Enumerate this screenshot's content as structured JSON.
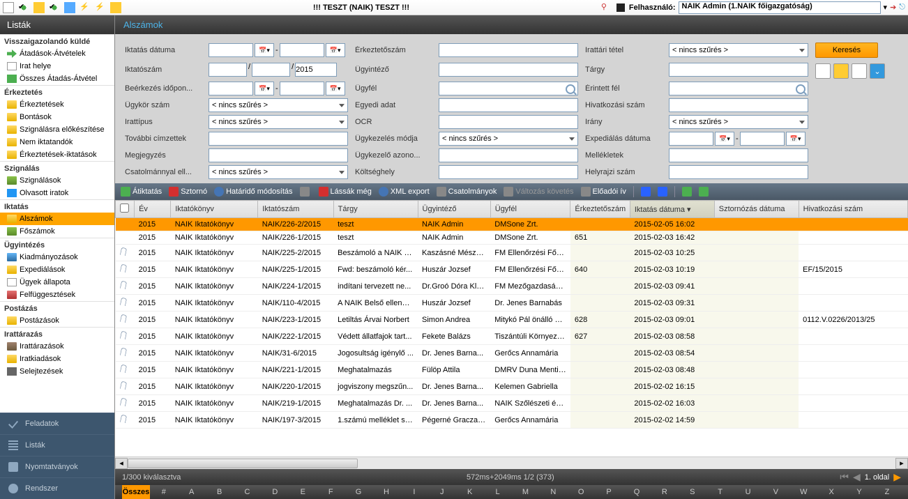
{
  "topbar": {
    "title": "!!! TESZT (NAIK) TESZT !!!",
    "user_label": "Felhasználó:",
    "user_value": "NAIK Admin (1.NAIK főigazgatóság)"
  },
  "sidebar": {
    "title": "Listák",
    "groups": [
      {
        "label": "Visszaigazolandó küldé",
        "items": [
          {
            "icon": "icon-arrows",
            "label": "Átadások-Átvételek"
          },
          {
            "icon": "icon-paper",
            "label": "Irat helye"
          },
          {
            "icon": "icon-grid",
            "label": "Összes Átadás-Átvétel"
          }
        ]
      },
      {
        "label": "Érkeztetés",
        "items": [
          {
            "icon": "folder-yellow",
            "label": "Érkeztetések"
          },
          {
            "icon": "folder-yellow",
            "label": "Bontások"
          },
          {
            "icon": "folder-yellow",
            "label": "Szignálásra előkészítése"
          },
          {
            "icon": "folder-yellow",
            "label": "Nem iktatandók"
          },
          {
            "icon": "folder-yellow",
            "label": "Érkeztetések-iktatások"
          }
        ]
      },
      {
        "label": "Szignálás",
        "items": [
          {
            "icon": "folder-green",
            "label": "Szignálások"
          },
          {
            "icon": "icon-check-blue",
            "label": "Olvasott iratok"
          }
        ]
      },
      {
        "label": "Iktatás",
        "items": [
          {
            "icon": "folder-yellow",
            "label": "Alszámok",
            "active": true
          },
          {
            "icon": "folder-green",
            "label": "Főszámok"
          }
        ]
      },
      {
        "label": "Ügyintézés",
        "items": [
          {
            "icon": "folder-blue",
            "label": "Kiadmányozások"
          },
          {
            "icon": "folder-yellow",
            "label": "Expediálások"
          },
          {
            "icon": "icon-paper",
            "label": "Ügyek állapota"
          },
          {
            "icon": "folder-red",
            "label": "Felfüggesztések"
          }
        ]
      },
      {
        "label": "Postázás",
        "items": [
          {
            "icon": "folder-yellow",
            "label": "Postázások"
          }
        ]
      },
      {
        "label": "Irattárazás",
        "items": [
          {
            "icon": "folder-brown",
            "label": "Irattárazások"
          },
          {
            "icon": "folder-yellow",
            "label": "Iratkiadások"
          },
          {
            "icon": "icon-trash",
            "label": "Selejtezések"
          }
        ]
      }
    ],
    "bottom": [
      {
        "icon": "sb-check",
        "label": "Feladatok"
      },
      {
        "icon": "sb-lines",
        "label": "Listák"
      },
      {
        "icon": "sb-print",
        "label": "Nyomtatványok"
      },
      {
        "icon": "sb-gear",
        "label": "Rendszer"
      }
    ]
  },
  "content_title": "Alszámok",
  "filters": {
    "labels": {
      "iktatas_datuma": "Iktatás dátuma",
      "iktatoszam": "Iktatószám",
      "beerkezes": "Beérkezés időpon...",
      "ugykor": "Ügykör szám",
      "irattipus": "Irattípus",
      "tovabbi": "További címzettek",
      "megjegyzes": "Megjegyzés",
      "csatolmany": "Csatolmánnyal ell...",
      "erkeztetoszam": "Érkeztetőszám",
      "ugyintezo": "Ügyintéző",
      "ugyfel": "Ügyfél",
      "egyediadat": "Egyedi adat",
      "ocr": "OCR",
      "ugykezelesmodja": "Ügykezelés módja",
      "ugykezeloazon": "Ügykezelő azono...",
      "koltseghely": "Költséghely",
      "irattaritetl": "Irattári tétel",
      "targy": "Tárgy",
      "erintettfel": "Érintett fél",
      "hivatkozasiszam": "Hivatkozási szám",
      "irany": "Irány",
      "expedialas": "Expediálás dátuma",
      "mellekletek": "Mellékletek",
      "helyrajziszam": "Helyrajzi szám"
    },
    "nofilter": "< nincs szűrés >",
    "year": "2015",
    "search_btn": "Keresés"
  },
  "actions": [
    {
      "icon": "abi-green",
      "label": "Átiktatás"
    },
    {
      "icon": "abi-red",
      "label": "Sztornó"
    },
    {
      "icon": "abi-blue",
      "label": "Határidő módosítás"
    },
    {
      "icon": "abi-gray",
      "label": ""
    },
    {
      "icon": "abi-red",
      "label": "Lássák még"
    },
    {
      "icon": "abi-blue",
      "label": "XML export"
    },
    {
      "icon": "abi-gray",
      "label": "Csatolmányok"
    },
    {
      "icon": "abi-gray",
      "label": "Változás követés",
      "disabled": true
    },
    {
      "icon": "abi-gray",
      "label": "Előadói ív"
    }
  ],
  "columns": [
    "",
    "Év",
    "Iktatókönyv",
    "Iktatószám",
    "Tárgy",
    "Ügyintéző",
    "Ügyfél",
    "Érkeztetőszám",
    "Iktatás dátuma",
    "Sztornózás dátuma",
    "Hivatkozási szám"
  ],
  "rows": [
    {
      "clip": false,
      "ev": "2015",
      "konyv": "NAIK Iktatókönyv",
      "szam": "NAIK/226-2/2015",
      "targy": "teszt",
      "ugyintezo": "NAIK Admin",
      "ugyfel": "DMSone Zrt.",
      "erk": "",
      "datum": "2015-02-05 16:02",
      "sztorno": "",
      "hiv": "",
      "selected": true
    },
    {
      "clip": false,
      "ev": "2015",
      "konyv": "NAIK Iktatókönyv",
      "szam": "NAIK/226-1/2015",
      "targy": "teszt",
      "ugyintezo": "NAIK Admin",
      "ugyfel": "DMSone Zrt.",
      "erk": "651",
      "datum": "2015-02-03 16:42",
      "sztorno": "",
      "hiv": ""
    },
    {
      "clip": true,
      "ev": "2015",
      "konyv": "NAIK Iktatókönyv",
      "szam": "NAIK/225-2/2015",
      "targy": "Beszámoló a NAIK 2...",
      "ugyintezo": "Kaszásné Mészá...",
      "ugyfel": "FM Ellenőrzési Főosz...",
      "erk": "",
      "datum": "2015-02-03 10:25",
      "sztorno": "",
      "hiv": ""
    },
    {
      "clip": true,
      "ev": "2015",
      "konyv": "NAIK Iktatókönyv",
      "szam": "NAIK/225-1/2015",
      "targy": "Fwd: beszámoló kér...",
      "ugyintezo": "Huszár Jozsef",
      "ugyfel": "FM Ellenőrzési Főosz...",
      "erk": "640",
      "datum": "2015-02-03 10:19",
      "sztorno": "",
      "hiv": "EF/15/2015"
    },
    {
      "clip": true,
      "ev": "2015",
      "konyv": "NAIK Iktatókönyv",
      "szam": "NAIK/224-1/2015",
      "targy": "indítani tervezett ne...",
      "ugyintezo": "Dr.Groó Dóra Klára",
      "ugyfel": "FM Mezőgazdasági F...",
      "erk": "",
      "datum": "2015-02-03 09:41",
      "sztorno": "",
      "hiv": ""
    },
    {
      "clip": true,
      "ev": "2015",
      "konyv": "NAIK Iktatókönyv",
      "szam": "NAIK/110-4/2015",
      "targy": "A NAIK Belső ellenőr...",
      "ugyintezo": "Huszár Jozsef",
      "ugyfel": "Dr. Jenes Barnabás",
      "erk": "",
      "datum": "2015-02-03 09:31",
      "sztorno": "",
      "hiv": ""
    },
    {
      "clip": true,
      "ev": "2015",
      "konyv": "NAIK Iktatókönyv",
      "szam": "NAIK/223-1/2015",
      "targy": "Letiltás Árvai Norbert",
      "ugyintezo": "Simon Andrea",
      "ugyfel": "Mitykó Pál önálló bíró...",
      "erk": "628",
      "datum": "2015-02-03 09:01",
      "sztorno": "",
      "hiv": "0112.V.0226/2013/25"
    },
    {
      "clip": true,
      "ev": "2015",
      "konyv": "NAIK Iktatókönyv",
      "szam": "NAIK/222-1/2015",
      "targy": "Védett állatfajok tart...",
      "ugyintezo": "Fekete Balázs",
      "ugyfel": "Tiszántúli Környezet...",
      "erk": "627",
      "datum": "2015-02-03 08:58",
      "sztorno": "",
      "hiv": ""
    },
    {
      "clip": true,
      "ev": "2015",
      "konyv": "NAIK Iktatókönyv",
      "szam": "NAIK/31-6/2015",
      "targy": "Jogosultság igénylő ...",
      "ugyintezo": "Dr. Jenes Barna...",
      "ugyfel": "Gerőcs Annamária",
      "erk": "",
      "datum": "2015-02-03 08:54",
      "sztorno": "",
      "hiv": ""
    },
    {
      "clip": true,
      "ev": "2015",
      "konyv": "NAIK Iktatókönyv",
      "szam": "NAIK/221-1/2015",
      "targy": "Meghatalmazás",
      "ugyintezo": "Fülöp Attila",
      "ugyfel": "DMRV Duna Menti R...",
      "erk": "",
      "datum": "2015-02-03 08:48",
      "sztorno": "",
      "hiv": ""
    },
    {
      "clip": true,
      "ev": "2015",
      "konyv": "NAIK Iktatókönyv",
      "szam": "NAIK/220-1/2015",
      "targy": "jogviszony megszűn...",
      "ugyintezo": "Dr. Jenes Barna...",
      "ugyfel": "Kelemen Gabriella",
      "erk": "",
      "datum": "2015-02-02 16:15",
      "sztorno": "",
      "hiv": ""
    },
    {
      "clip": true,
      "ev": "2015",
      "konyv": "NAIK Iktatókönyv",
      "szam": "NAIK/219-1/2015",
      "targy": "Meghatalmazás Dr. ...",
      "ugyintezo": "Dr. Jenes Barna...",
      "ugyfel": "NAIK Szőlészeti és B...",
      "erk": "",
      "datum": "2015-02-02 16:03",
      "sztorno": "",
      "hiv": ""
    },
    {
      "clip": true,
      "ev": "2015",
      "konyv": "NAIK Iktatókönyv",
      "szam": "NAIK/197-3/2015",
      "targy": "1.számú melléklet sz...",
      "ugyintezo": "Pégerné Gracza ...",
      "ugyfel": "Gerőcs Annamária",
      "erk": "",
      "datum": "2015-02-02 14:59",
      "sztorno": "",
      "hiv": ""
    }
  ],
  "status": {
    "left": "1/300 kiválasztva",
    "center": "572ms+2049ms 1/2 (373)",
    "page": "1. oldal"
  },
  "alpha": [
    "Összes",
    "#",
    "A",
    "B",
    "C",
    "D",
    "E",
    "F",
    "G",
    "H",
    "I",
    "J",
    "K",
    "L",
    "M",
    "N",
    "O",
    "P",
    "Q",
    "R",
    "S",
    "T",
    "U",
    "V",
    "W",
    "X",
    "Y",
    "Z"
  ]
}
